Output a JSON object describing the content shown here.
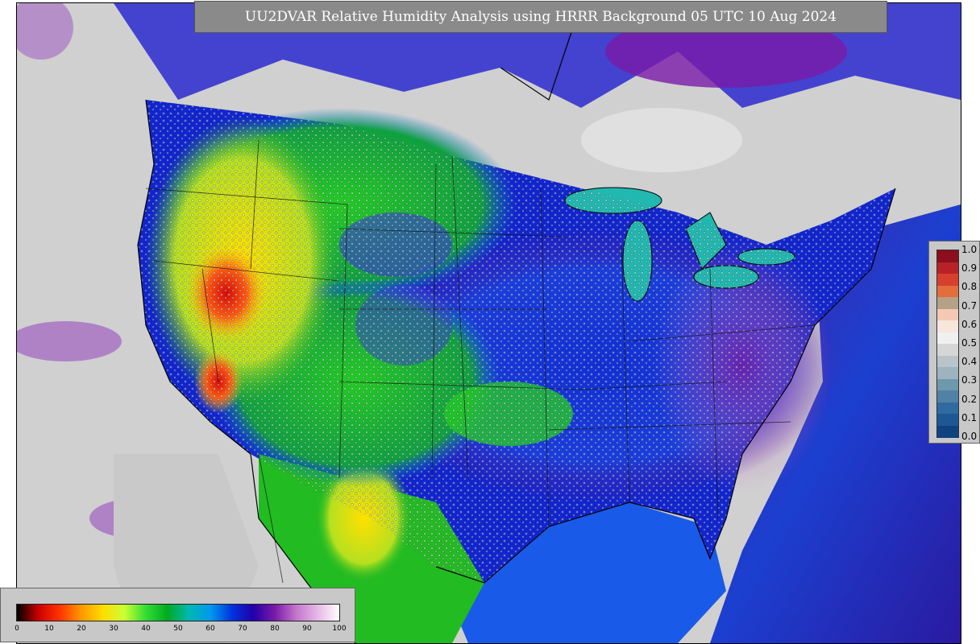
{
  "title": "UU2DVAR Relative Humidity Analysis using HRRR Background 05 UTC 10 Aug 2024",
  "right_legend": {
    "labels": [
      "1.0",
      "0.9",
      "0.8",
      "0.7",
      "0.6",
      "0.5",
      "0.4",
      "0.3",
      "0.2",
      "0.1",
      "0.0"
    ],
    "colors": [
      "#8b0f1c",
      "#b82227",
      "#d7402e",
      "#e36e3c",
      "#b4a186",
      "#f4c9b4",
      "#f7e6dc",
      "#f0f0f0",
      "#d6d6d6",
      "#b8c4ca",
      "#9db3bd",
      "#6e98ab",
      "#4f82a6",
      "#2f6ba0",
      "#1d5894",
      "#10427f"
    ]
  },
  "bottom_legend": {
    "labels": [
      "0",
      "10",
      "20",
      "30",
      "40",
      "50",
      "60",
      "70",
      "80",
      "90",
      "100"
    ],
    "colors": [
      "#000000",
      "#cc0000",
      "#ff3300",
      "#ff9900",
      "#ffdd00",
      "#ccff33",
      "#33dd33",
      "#00aa22",
      "#00b8b0",
      "#0099ee",
      "#0033dd",
      "#2200aa",
      "#7a1aa8",
      "#c477cc",
      "#e6b8e6",
      "#ffffff"
    ]
  },
  "map": {
    "land_colors": {
      "dry": "#e01010",
      "mid": "#ffd200",
      "moist": "#22bb22",
      "wet": "#0a2ed8",
      "humid": "#6a1a9a",
      "ocean": "#1b4fd6",
      "nodata": "#d0d0d0"
    }
  }
}
